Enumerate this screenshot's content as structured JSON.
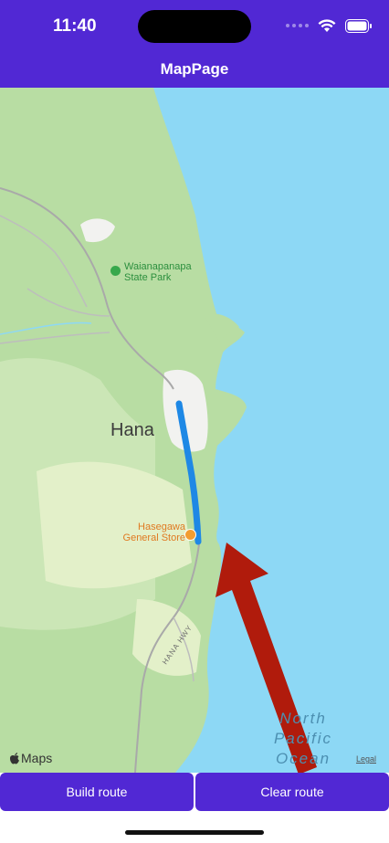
{
  "status_bar": {
    "time": "11:40",
    "icons": [
      "signal-dots-icon",
      "wifi-icon",
      "battery-icon"
    ]
  },
  "nav": {
    "title": "MapPage"
  },
  "map": {
    "town_label": "Hana",
    "park_label": "Waianapanapa State Park",
    "store_label": "Hasegawa General Store",
    "ocean_label": "North Pacific Ocean",
    "road_label": "HANA HWY",
    "logo_text": "Maps",
    "legal_text": "Legal"
  },
  "buttons": {
    "build_label": "Build route",
    "clear_label": "Clear route"
  },
  "colors": {
    "header": "#5128D4",
    "button": "#5128D4",
    "water": "#8DD8F5",
    "land": "#B8DDA3",
    "route": "#1E88E5",
    "arrow": "#B01B0C"
  }
}
